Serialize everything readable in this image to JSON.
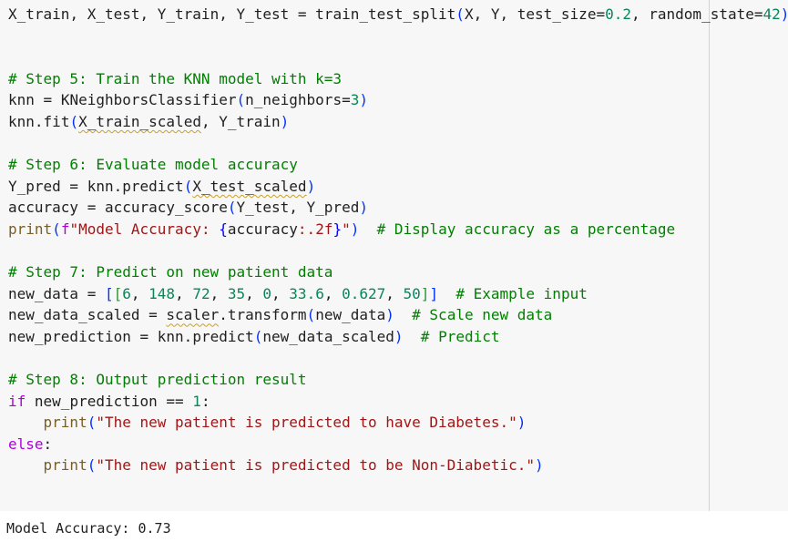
{
  "cell": {
    "lines": [
      "X_train, X_test, Y_train, Y_test = train_test_split(X, Y, test_size=0.2, random_state=42)",
      "",
      "",
      "# Step 5: Train the KNN model with k=3",
      "knn = KNeighborsClassifier(n_neighbors=3)",
      "knn.fit(X_train_scaled, Y_train)",
      "",
      "# Step 6: Evaluate model accuracy",
      "Y_pred = knn.predict(X_test_scaled)",
      "accuracy = accuracy_score(Y_test, Y_pred)",
      "print(f\"Model Accuracy: {accuracy:.2f}\")  # Display accuracy as a percentage",
      "",
      "# Step 7: Predict on new patient data",
      "new_data = [[6, 148, 72, 35, 0, 33.6, 0.627, 50]]  # Example input",
      "new_data_scaled = scaler.transform(new_data)  # Scale new data",
      "new_prediction = knn.predict(new_data_scaled)  # Predict",
      "",
      "# Step 8: Output prediction result",
      "if new_prediction == 1:",
      "    print(\"The new patient is predicted to have Diabetes.\")",
      "else:",
      "    print(\"The new patient is predicted to be Non-Diabetic.\")"
    ]
  },
  "output": {
    "text": "Model Accuracy: 0.73"
  },
  "colors": {
    "cell_background": "#f7f7f7",
    "comment": "#008000",
    "string": "#a31515",
    "number": "#098658",
    "keyword": "#af00db",
    "function": "#795e26",
    "bracket_level1": "#0431fa",
    "bracket_level2": "#319331",
    "warning_squiggle": "#c8a02a"
  }
}
